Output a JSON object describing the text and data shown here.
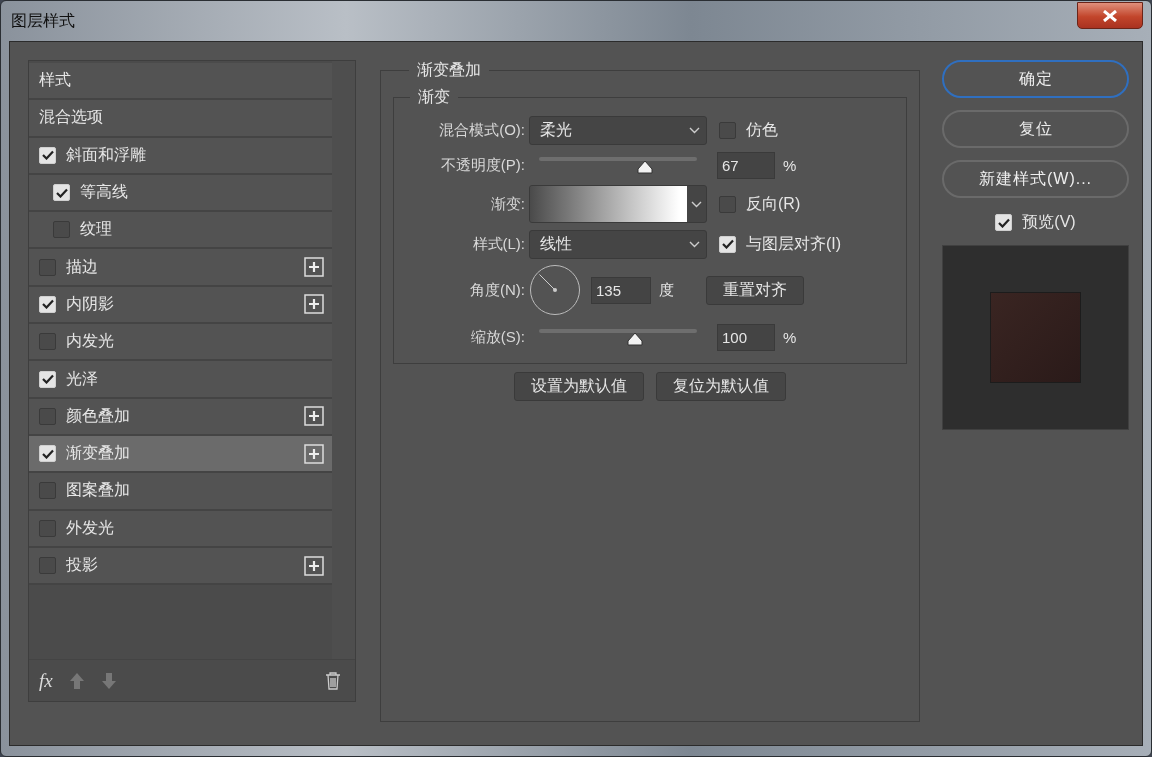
{
  "window": {
    "title": "图层样式"
  },
  "styles": [
    {
      "label": "样式",
      "kind": "header",
      "selected": false
    },
    {
      "label": "混合选项",
      "kind": "header",
      "selected": false
    },
    {
      "label": "斜面和浮雕",
      "kind": "effect",
      "checked": true,
      "selected": false,
      "addable": false,
      "children": [
        {
          "label": "等高线",
          "kind": "effect",
          "checked": true,
          "selected": false,
          "addable": false
        },
        {
          "label": "纹理",
          "kind": "effect",
          "checked": false,
          "selected": false,
          "addable": false
        }
      ]
    },
    {
      "label": "描边",
      "kind": "effect",
      "checked": false,
      "selected": false,
      "addable": true
    },
    {
      "label": "内阴影",
      "kind": "effect",
      "checked": true,
      "selected": false,
      "addable": true
    },
    {
      "label": "内发光",
      "kind": "effect",
      "checked": false,
      "selected": false,
      "addable": false
    },
    {
      "label": "光泽",
      "kind": "effect",
      "checked": true,
      "selected": false,
      "addable": false
    },
    {
      "label": "颜色叠加",
      "kind": "effect",
      "checked": false,
      "selected": false,
      "addable": true
    },
    {
      "label": "渐变叠加",
      "kind": "effect",
      "checked": true,
      "selected": true,
      "addable": true
    },
    {
      "label": "图案叠加",
      "kind": "effect",
      "checked": false,
      "selected": false,
      "addable": false
    },
    {
      "label": "外发光",
      "kind": "effect",
      "checked": false,
      "selected": false,
      "addable": false
    },
    {
      "label": "投影",
      "kind": "effect",
      "checked": false,
      "selected": false,
      "addable": true
    }
  ],
  "list_footer": {
    "fx": "fx"
  },
  "panel": {
    "title": "渐变叠加",
    "group_title": "渐变",
    "blend_mode": {
      "label": "混合模式(O):",
      "value": "柔光"
    },
    "dither": {
      "label": "仿色",
      "checked": false
    },
    "opacity": {
      "label": "不透明度(P):",
      "level": 0.67,
      "value": "67",
      "unit": "%"
    },
    "gradient": {
      "label": "渐变:"
    },
    "reverse": {
      "label": "反向(R)",
      "checked": false
    },
    "style": {
      "label": "样式(L):",
      "value": "线性"
    },
    "align": {
      "label": "与图层对齐(I)",
      "checked": true
    },
    "angle": {
      "label": "角度(N):",
      "value": "135",
      "unit": "度"
    },
    "reset_align": "重置对齐",
    "scale": {
      "label": "缩放(S):",
      "level": 0.61,
      "value": "100",
      "unit": "%"
    },
    "buttons": [
      "设置为默认值",
      "复位为默认值"
    ]
  },
  "actions": [
    {
      "label": "确定",
      "default": true
    },
    {
      "label": "复位",
      "default": false
    },
    {
      "label": "新建样式(W)...",
      "default": false
    }
  ],
  "preview": {
    "label": "预览(V)",
    "checked": true
  }
}
